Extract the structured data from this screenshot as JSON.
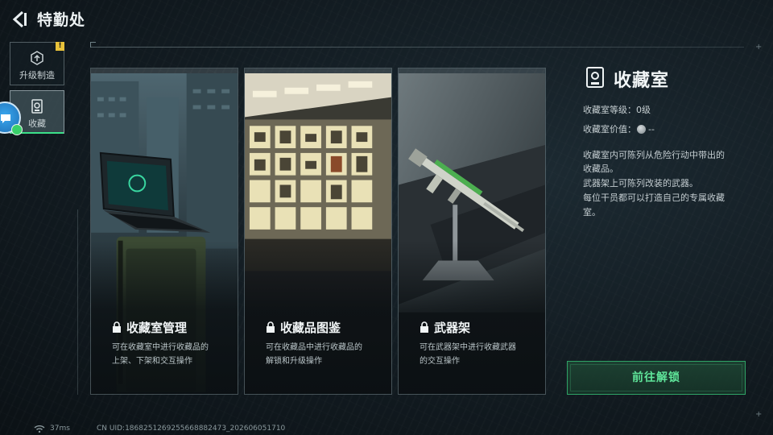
{
  "header": {
    "title": "特勤处"
  },
  "sidebar": {
    "items": [
      {
        "label": "升级制造",
        "icon": "upgrade-icon",
        "badge": "!"
      },
      {
        "label": "收藏",
        "icon": "collection-icon",
        "active": true
      }
    ]
  },
  "cards": [
    {
      "title": "收藏室管理",
      "desc": "可在收藏室中进行收藏品的上架、下架和交互操作",
      "desc_lines": [
        "可在收藏室中进行收藏品的",
        "上架、下架和交互操作"
      ],
      "locked": true
    },
    {
      "title": "收藏品图鉴",
      "desc_lines": [
        "可在收藏品中进行收藏品的",
        "解锁和升级操作"
      ],
      "locked": true
    },
    {
      "title": "武器架",
      "desc_lines": [
        "可在武器架中进行收藏武器",
        "的交互操作"
      ],
      "locked": true
    }
  ],
  "info": {
    "title": "收藏室",
    "level_label": "收藏室等级：",
    "level_value": "0级",
    "worth_label": "收藏室价值：",
    "worth_value": "--",
    "description_lines": [
      "收藏室内可陈列从危险行动中带出的",
      "收藏品。",
      "武器架上可陈列改装的武器。",
      "每位干员都可以打造自己的专属收藏",
      "室。"
    ]
  },
  "actions": {
    "unlock_label": "前往解锁"
  },
  "footer": {
    "ping": "37ms",
    "uid": "CN UID:1868251269255668882473_202606051710"
  },
  "colors": {
    "accent": "#3be089",
    "button_text": "#5fe59a",
    "badge": "#e8c23a",
    "assist": "#2f8fd8"
  }
}
